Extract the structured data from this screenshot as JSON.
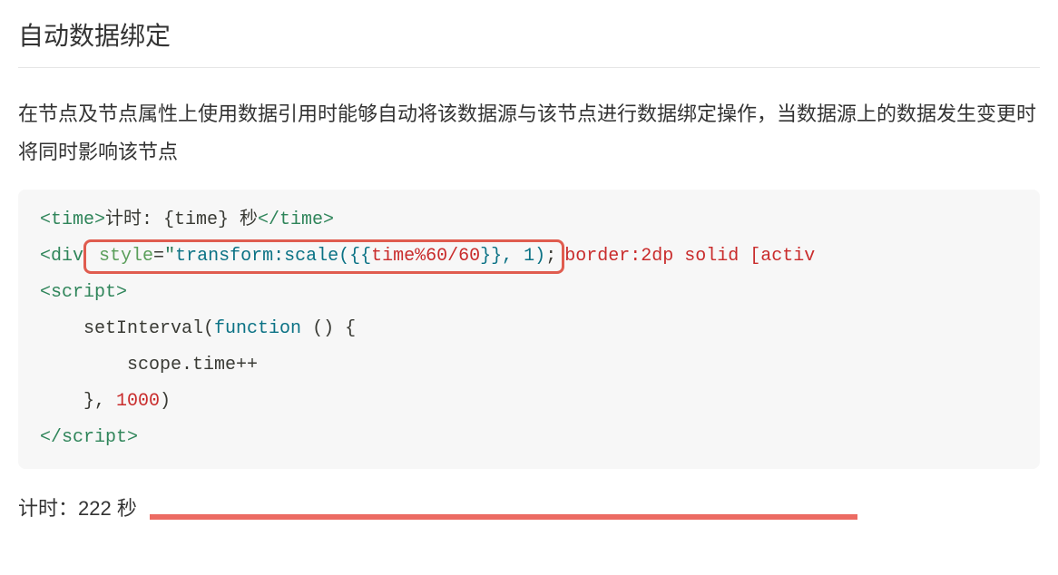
{
  "title": "自动数据绑定",
  "paragraph": "在节点及节点属性上使用数据引用时能够自动将该数据源与该节点进行数据绑定操作，当数据源上的数据发生变更时将同时影响该节点",
  "code": {
    "line1": {
      "open_tag": "<time>",
      "text": "计时: {time} 秒",
      "close_tag": "</time>"
    },
    "line2": {
      "open": "<div",
      "space": " ",
      "style_attr": "style",
      "eq": "=",
      "q1": "\"",
      "val1": "transform:scale(",
      "expr_open": "{{",
      "expr": "time%60/60",
      "expr_close": "}}",
      "val_after": ", 1)",
      "q2": ";",
      "border": "border:2dp solid [activ"
    },
    "line3": {
      "open": "<script>"
    },
    "line4": {
      "indent": "    ",
      "call": "setInterval(",
      "fn_kw": "function",
      "fn_parens": " () {"
    },
    "line5": {
      "indent": "        ",
      "body": "scope.time++"
    },
    "line6": {
      "indent": "    ",
      "close1": "}, ",
      "num": "1000",
      "close2": ")"
    },
    "line7": {
      "close": "</scr",
      "close2": "ipt>"
    }
  },
  "timer": {
    "label": "计时：222 秒"
  }
}
